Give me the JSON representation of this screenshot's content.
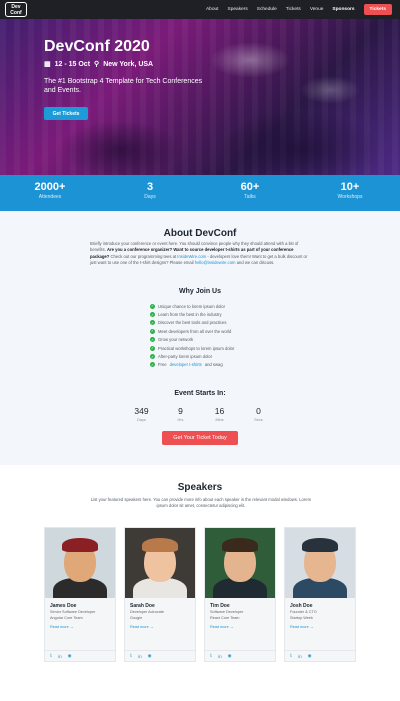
{
  "nav": {
    "logo": "Dev Conf",
    "links": [
      "About",
      "Speakers",
      "Schedule",
      "Tickets",
      "Venue",
      "Sponsors"
    ],
    "tickets_button": "Tickets"
  },
  "hero": {
    "title": "DevConf 2020",
    "date": "12 - 15 Oct",
    "location": "New York, USA",
    "tagline": "The #1 Bootstrap 4 Template for Tech Conferences and Events.",
    "button": "Get Tickets"
  },
  "stats": [
    {
      "value": "2000+",
      "label": "Attendees"
    },
    {
      "value": "3",
      "label": "Days"
    },
    {
      "value": "60+",
      "label": "Talks"
    },
    {
      "value": "10+",
      "label": "Workshops"
    }
  ],
  "about": {
    "title": "About DevConf",
    "text_1": "Briefly introduce your conference or event here. You should convince people why they should attend with a list of benefits. ",
    "text_bold": "Are you a conference organizer? Want to source developer t-shirts as part of your conference package?",
    "text_2": " Check out our programming tees at ",
    "link_1": "InsideWire.com",
    "text_3": " - developers love them! Want to get a bulk discount or just want to use one of the t-shirt designs? Please email ",
    "link_2": "hello@insidewire.com",
    "text_4": " and we can discuss."
  },
  "why": {
    "title": "Why Join Us",
    "items": [
      "Unique chance to lorem ipsum dolor",
      "Learn from the best in the industry",
      "Discover the best tools and practices",
      "Meet developers from all over the world",
      "Grow your network",
      "Practical workshops to lorem ipsum dolor",
      "After-party lorem ipsum dolor"
    ],
    "last_prefix": "Free ",
    "last_link": "developer t-shirts",
    "last_suffix": " and swag"
  },
  "event": {
    "title": "Event Starts In:",
    "countdown": [
      {
        "value": "349",
        "label": "Days"
      },
      {
        "value": "9",
        "label": "Hrs"
      },
      {
        "value": "16",
        "label": "Mins"
      },
      {
        "value": "0",
        "label": "Secs"
      }
    ],
    "cta": "Get Your Ticket Today"
  },
  "speakers": {
    "title": "Speakers",
    "desc": "List your featured speakers here. You can provide more info about each speaker in the relevant modal windows. Lorem ipsum dolor sit amet, consectetur adipiscing elit.",
    "more_label": "Read more →",
    "cards": [
      {
        "name": "James Doe",
        "role": "Senior Software Developer",
        "org": "Angular Core Team",
        "bg": "#cfd8dc",
        "skin": "#e0a878",
        "shirt": "#2b2b2b",
        "hair": "#8a1f24"
      },
      {
        "name": "Sarah Doe",
        "role": "Developer Advocate",
        "org": "Google",
        "bg": "#3e3a36",
        "skin": "#efc2a0",
        "shirt": "#e8e6e2",
        "hair": "#b87a4b"
      },
      {
        "name": "Tim Doe",
        "role": "Software Developer",
        "org": "React Core Team",
        "bg": "#2f5d3a",
        "skin": "#e3b48e",
        "shirt": "#1f2a33",
        "hair": "#3a2a1e"
      },
      {
        "name": "Josh Doe",
        "role": "Founder & CTO",
        "org": "Startup Week",
        "bg": "#d6dde3",
        "skin": "#e6b690",
        "shirt": "#2c4a63",
        "hair": "#27323c"
      }
    ]
  }
}
